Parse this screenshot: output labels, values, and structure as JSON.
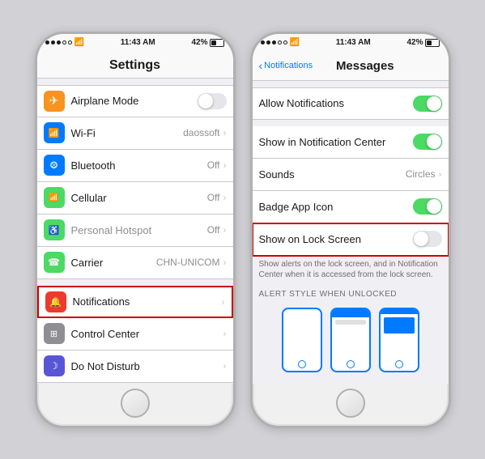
{
  "left_phone": {
    "status_bar": {
      "time": "11:43 AM",
      "battery": "42%"
    },
    "title": "Settings",
    "sections": [
      {
        "items": [
          {
            "id": "airplane",
            "icon_color": "#f7931e",
            "icon": "✈",
            "label": "Airplane Mode",
            "value": "",
            "has_toggle": true,
            "toggle_on": false
          },
          {
            "id": "wifi",
            "icon_color": "#007aff",
            "icon": "📶",
            "label": "Wi-Fi",
            "value": "daossoft",
            "has_chevron": true
          },
          {
            "id": "bluetooth",
            "icon_color": "#007aff",
            "icon": "✦",
            "label": "Bluetooth",
            "value": "Off",
            "has_chevron": true
          },
          {
            "id": "cellular",
            "icon_color": "#4cd964",
            "icon": "◉",
            "label": "Cellular",
            "value": "Off",
            "has_chevron": true
          },
          {
            "id": "hotspot",
            "icon_color": "#4cd964",
            "icon": "⊙",
            "label": "Personal Hotspot",
            "value": "Off",
            "has_chevron": true
          },
          {
            "id": "carrier",
            "icon_color": "#4cd964",
            "icon": "☏",
            "label": "Carrier",
            "value": "CHN-UNICOM",
            "has_chevron": true
          }
        ]
      },
      {
        "items": [
          {
            "id": "notifications",
            "icon_color": "#ee3a2d",
            "icon": "🔔",
            "label": "Notifications",
            "value": "",
            "has_chevron": true,
            "highlighted": true
          },
          {
            "id": "control_center",
            "icon_color": "#8e8e93",
            "icon": "⊞",
            "label": "Control Center",
            "value": "",
            "has_chevron": true
          },
          {
            "id": "do_not_disturb",
            "icon_color": "#5856d6",
            "icon": "☽",
            "label": "Do Not Disturb",
            "value": "",
            "has_chevron": true
          }
        ]
      }
    ]
  },
  "right_phone": {
    "status_bar": {
      "time": "11:43 AM",
      "battery": "42%"
    },
    "nav": {
      "back_label": "Notifications",
      "title": "Messages"
    },
    "rows": [
      {
        "id": "allow_notif",
        "label": "Allow Notifications",
        "has_toggle": true,
        "toggle_on": true
      },
      {
        "id": "show_notif_center",
        "label": "Show in Notification Center",
        "has_toggle": true,
        "toggle_on": true
      },
      {
        "id": "sounds",
        "label": "Sounds",
        "value": "Circles",
        "has_chevron": true
      },
      {
        "id": "badge_app_icon",
        "label": "Badge App Icon",
        "has_toggle": true,
        "toggle_on": true
      },
      {
        "id": "show_lock_screen",
        "label": "Show on Lock Screen",
        "has_toggle": true,
        "toggle_on": false,
        "highlighted": true
      }
    ],
    "description": "Show alerts on the lock screen, and in Notification Center when it is accessed from the lock screen.",
    "alert_style_header": "ALERT STYLE WHEN UNLOCKED"
  }
}
